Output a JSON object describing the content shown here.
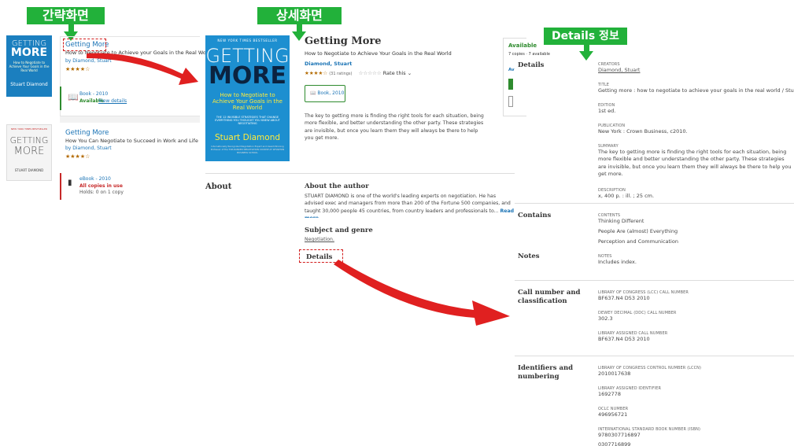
{
  "labels": {
    "brief": "간략화면",
    "detail": "상세화면",
    "details_info": "Details 정보"
  },
  "list": {
    "item1": {
      "cover": {
        "line1": "GETTING",
        "line2": "MORE",
        "sub": "How to Negotiate to Achieve Your Goals in the Real World",
        "author": "Stuart Diamond"
      },
      "title": "Getting More",
      "subtitle": "How to Negotiate to Achieve your Goals in the Real World",
      "author": "by Diamond, Stuart",
      "stars": "★★★★☆",
      "format": "Book - 2010",
      "status": "Available",
      "view_details": "View details"
    },
    "item2": {
      "cover": {
        "top": "NEW YORK TIMES BESTSELLER",
        "line1": "GETTING",
        "line2": "MORE",
        "author": "STUART DIAMOND"
      },
      "title": "Getting More",
      "subtitle": "How You Can Negotiate to Succeed in Work and Life",
      "author": "by Diamond, Stuart",
      "stars": "★★★★☆",
      "format": "eBook - 2010",
      "status": "All copies in use",
      "holds": "Holds: 0 on 1 copy"
    }
  },
  "detail": {
    "cover": {
      "top": "NEW YORK TIMES BESTSELLER",
      "line1": "GETTING",
      "line2": "MORE",
      "sub": "How to Negotiate to Achieve Your Goals in the Real World",
      "tagline": "THE 12 INVISIBLE STRATEGIES THAT CHANGE EVERYTHING YOU THOUGHT YOU KNEW ABOUT NEGOTIATING",
      "author": "Stuart Diamond",
      "foot": "Internationally Recognized Negotiation Expert and Award-Winning Professor of the TOP-RANKED NEGOTIATION COURSE AT WHARTON BUSINESS SCHOOL"
    },
    "title": "Getting More",
    "subtitle": "How to Negotiate to Achieve Your Goals in the Real World",
    "author": "Diamond, Stuart",
    "stars": "★★★★☆",
    "ratings": "(31 ratings)",
    "empty_stars": "☆☆☆☆☆",
    "rate_this": "Rate this ⌄",
    "format_btn": "Book, 2010",
    "description": "The key to getting more is finding the right tools for each situation, being more flexible, and better understanding the other party. These strategies are invisible, but once you learn them they will always be there to help you get more.",
    "about": "About",
    "about_author_h": "About the author",
    "about_author_text": "STUART DIAMOND is one of the world's leading experts on negotiation. He has advised exec and managers from more than 200 of the Fortune 500 companies, and taught 30,000 people 45 countries, from country leaders and professionals to...",
    "read_more": "Read more ⌄",
    "subject_h": "Subject and genre",
    "subject_link": "Negotiation.",
    "details_h": "Details"
  },
  "avail": {
    "title": "Available",
    "copies": "7 copies · 7 available",
    "av": "Av"
  },
  "details": {
    "heading": "Details",
    "creators_label": "CREATORS",
    "creators": "Diamond, Stuart",
    "title_label": "TITLE",
    "title": "Getting more : how to negotiate to achieve your goals in the real world / Stuart Diamor",
    "edition_label": "EDITION",
    "edition": "1st ed.",
    "publication_label": "PUBLICATION",
    "publication": "New York : Crown Business, c2010.",
    "summary_label": "SUMMARY",
    "summary": "The key to getting more is finding the right tools for each situation, being more flexible and better understanding the other party. These strategies are invisible, but once you learn them they will always be there to help you get more.",
    "description_label": "DESCRIPTION",
    "description": "x, 400 p. : ill. ; 25 cm.",
    "contains_h": "Contains",
    "contents_label": "CONTENTS",
    "contents": [
      "Thinking Different",
      "People Are (almost) Everything",
      "Perception and Communication"
    ],
    "notes_h": "Notes",
    "notes_label": "NOTES",
    "notes": "Includes index.",
    "call_h1": "Call number and",
    "call_h2": "classification",
    "lcc_label": "LIBRARY OF CONGRESS (LCC) CALL NUMBER",
    "lcc": "BF637.N4 D53 2010",
    "ddc_label": "DEWEY DECIMAL (DDC) CALL NUMBER",
    "ddc": "302.3",
    "lib_call_label": "LIBRARY ASSIGNED CALL NUMBER",
    "lib_call": "BF637.N4 D53 2010",
    "id_h1": "Identifiers and",
    "id_h2": "numbering",
    "lccn_label": "LIBRARY OF CONGRESS CONTROL NUMBER (LCCN)",
    "lccn": "2010017638",
    "lib_id_label": "LIBRARY ASSIGNED IDENTIFIER",
    "lib_id": "1692778",
    "oclc_label": "OCLC NUMBER",
    "oclc": "496956721",
    "isbn_label": "INTERNATIONAL STANDARD BOOK NUMBER (ISBN)",
    "isbn1": "9780307716897",
    "isbn2": "0307716899"
  }
}
